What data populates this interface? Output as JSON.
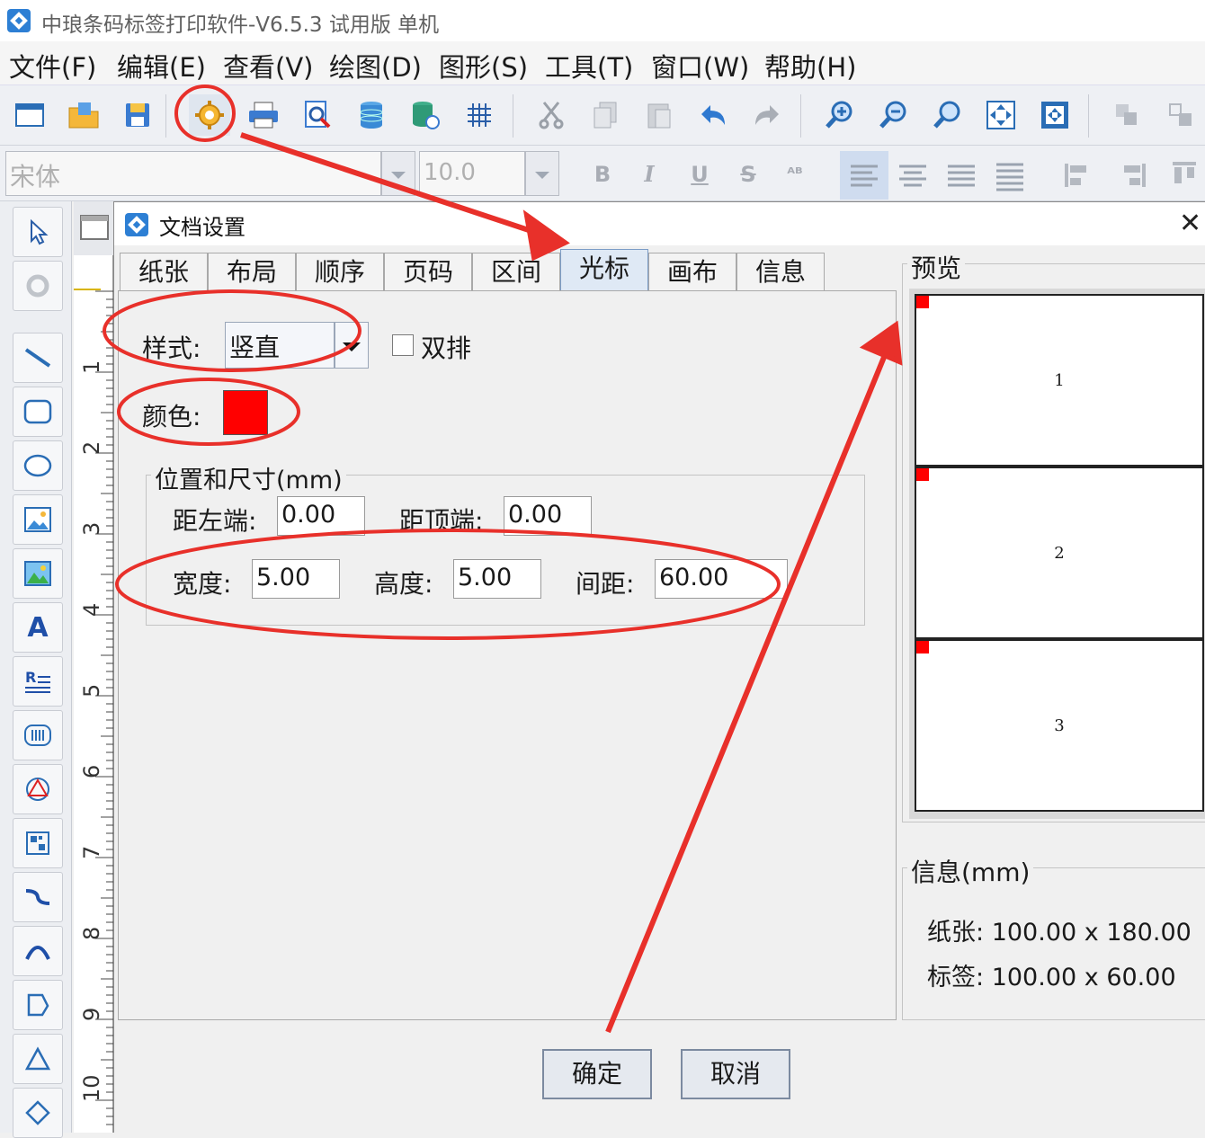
{
  "app": {
    "title": "中琅条码标签打印软件-V6.5.3 试用版 单机"
  },
  "menu": [
    "文件(F)",
    "编辑(E)",
    "查看(V)",
    "绘图(D)",
    "图形(S)",
    "工具(T)",
    "窗口(W)",
    "帮助(H)"
  ],
  "toolbar": {
    "icons": [
      "new-window-icon",
      "open-folder-icon",
      "save-icon",
      "document-settings-gear-icon",
      "print-icon",
      "print-preview-icon",
      "database-icon",
      "database-settings-icon",
      "grid-icon",
      "cut-icon",
      "copy-icon",
      "paste-icon",
      "undo-icon",
      "redo-icon",
      "zoom-in-icon",
      "zoom-out-icon",
      "zoom-icon",
      "fit-window-icon",
      "fit-page-icon",
      "group-icon",
      "ungroup-icon"
    ]
  },
  "font_toolbar": {
    "font_name": "宋体",
    "font_size": "10.0",
    "buttons": [
      "B",
      "I",
      "U",
      "S",
      "ᴬᴮ"
    ]
  },
  "ruler": {
    "numbers": [
      "1",
      "2",
      "3",
      "4",
      "5",
      "6",
      "7",
      "8",
      "9",
      "10"
    ]
  },
  "dialog": {
    "title": "文档设置",
    "tabs": [
      "纸张",
      "布局",
      "顺序",
      "页码",
      "区间",
      "光标",
      "画布",
      "信息"
    ],
    "active_tab": "光标",
    "style_label": "样式:",
    "style_value": "竖直",
    "double_label": "双排",
    "double_checked": false,
    "color_label": "颜色:",
    "color_value": "#ff0000",
    "position_group": "位置和尺寸(mm)",
    "left_label": "距左端:",
    "left_value": "0.00",
    "top_label": "距顶端:",
    "top_value": "0.00",
    "width_label": "宽度:",
    "width_value": "5.00",
    "height_label": "高度:",
    "height_value": "5.00",
    "spacing_label": "间距:",
    "spacing_value": "60.00",
    "ok_button": "确定",
    "cancel_button": "取消",
    "preview_label": "预览",
    "preview_labels": [
      "1",
      "2",
      "3"
    ],
    "info_label": "信息(mm)",
    "paper_label": "纸张:",
    "paper_value": "100.00 x 180.00",
    "label_label": "标签:",
    "label_value": "100.00 x 60.00"
  },
  "annotation_color": "#e8302a"
}
